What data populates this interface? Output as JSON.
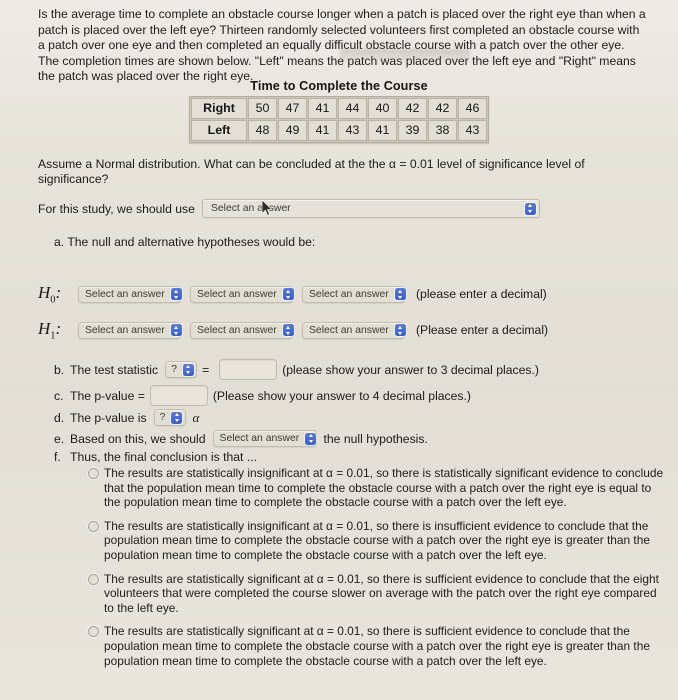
{
  "question": {
    "intro": "Is the average time to complete an obstacle course longer when a patch is placed over the right eye than when a patch is placed over the left eye? Thirteen randomly selected volunteers first completed an obstacle course with a patch over one eye and then completed an equally difficult obstacle course with a patch over the other eye. The completion times are shown below. \"Left\" means the patch was placed over the left eye and \"Right\" means the patch was placed over the right eye.",
    "assume": "Assume a Normal distribution.  What can be concluded at the the α = 0.01 level of significance level of significance?",
    "study_prompt": "For this study, we should use",
    "part_a": "a.  The null and alternative hypotheses would be:"
  },
  "table": {
    "caption": "Time to Complete the Course",
    "rows": [
      {
        "label": "Right",
        "values": [
          50,
          47,
          41,
          44,
          40,
          42,
          42,
          46
        ]
      },
      {
        "label": "Left",
        "values": [
          48,
          49,
          41,
          43,
          41,
          39,
          38,
          43
        ]
      }
    ]
  },
  "selects": {
    "placeholder": "Select an answer",
    "unknown": "?",
    "accent": "#4560c2"
  },
  "hypotheses": [
    {
      "name": "H",
      "sub": "0",
      "note": "(please enter a decimal)"
    },
    {
      "name": "H",
      "sub": "1",
      "note": "(Please enter a decimal)"
    }
  ],
  "parts": {
    "b": {
      "marker": "b.",
      "text": "The test statistic",
      "equals": "=",
      "note": "(please show your answer to 3 decimal places.)",
      "value": ""
    },
    "c": {
      "marker": "c.",
      "text": "The p-value =",
      "note": "(Please show your answer to 4 decimal places.)",
      "value": ""
    },
    "d": {
      "marker": "d.",
      "text": "The p-value is",
      "alpha": "α"
    },
    "e": {
      "marker": "e.",
      "text": "Based on this, we should",
      "tail": "the null hypothesis."
    },
    "f": {
      "marker": "f.",
      "text": "Thus, the final conclusion is that ..."
    }
  },
  "options": [
    "The results are statistically insignificant at α = 0.01, so there is statistically significant evidence to conclude that the population mean time to complete the obstacle course with a patch over the right eye is equal to the population mean time to complete the obstacle course with a patch over the left eye.",
    "The results are statistically insignificant at α = 0.01, so there is insufficient evidence to conclude that the population mean time to complete the obstacle course with a patch over the right eye is greater than the population mean time to complete the obstacle course with a patch over the left eye.",
    "The results are statistically significant at α = 0.01, so there is sufficient evidence to conclude that the eight volunteers that were completed the course slower on average with the patch over the right eye compared to the left eye.",
    "The results are statistically significant at α = 0.01, so there is sufficient evidence to conclude that the population mean time to complete the obstacle course with a patch over the right eye is greater than the population mean time to complete the obstacle course with a patch over the left eye."
  ]
}
